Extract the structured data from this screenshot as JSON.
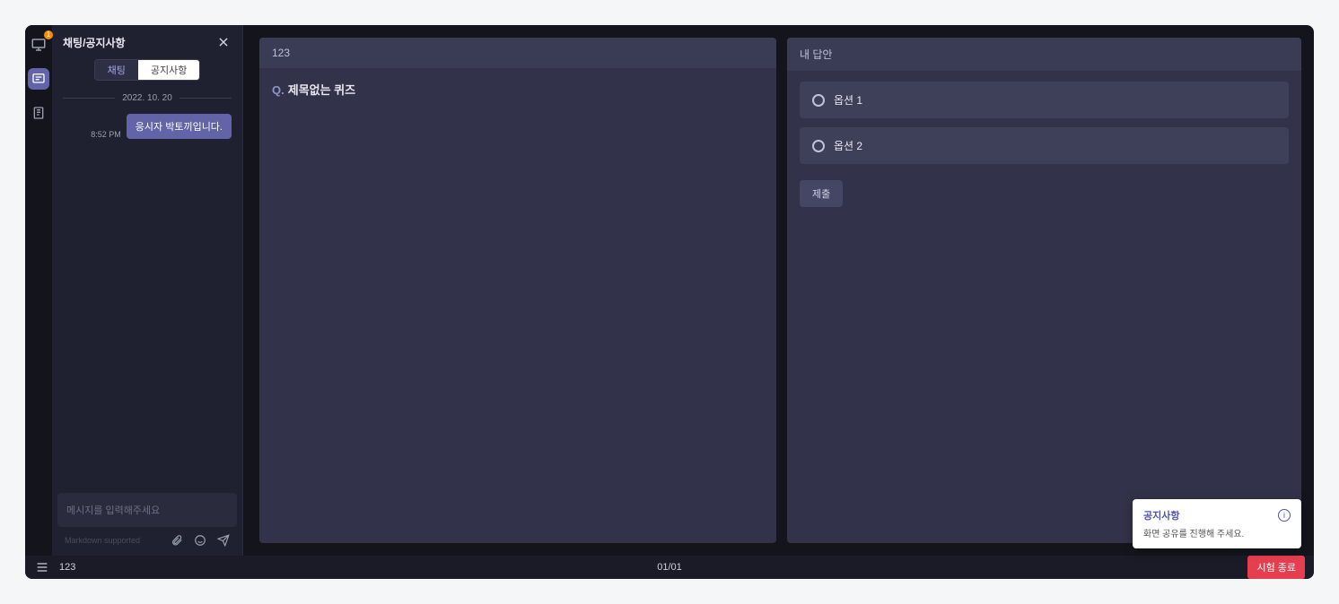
{
  "rail": {
    "notif_badge": "1"
  },
  "chat": {
    "title": "채팅/공지사항",
    "tabs": {
      "chat": "채팅",
      "notice": "공지사항"
    },
    "date": "2022. 10. 20",
    "msg_time": "8:52 PM",
    "msg_text": "응시자 박토끼입니다.",
    "input_placeholder": "메시지를 입력해주세요",
    "support": "Markdown supported"
  },
  "question": {
    "head": "123",
    "prefix": "Q.",
    "title": "제목없는 퀴즈"
  },
  "answer": {
    "head": "내 답안",
    "options": [
      "옵션 1",
      "옵션 2"
    ],
    "submit": "제출"
  },
  "footer": {
    "title": "123",
    "page": "01/01",
    "end": "시험 종료"
  },
  "toast": {
    "title": "공지사항",
    "body": "화면 공유를 진행해 주세요."
  }
}
